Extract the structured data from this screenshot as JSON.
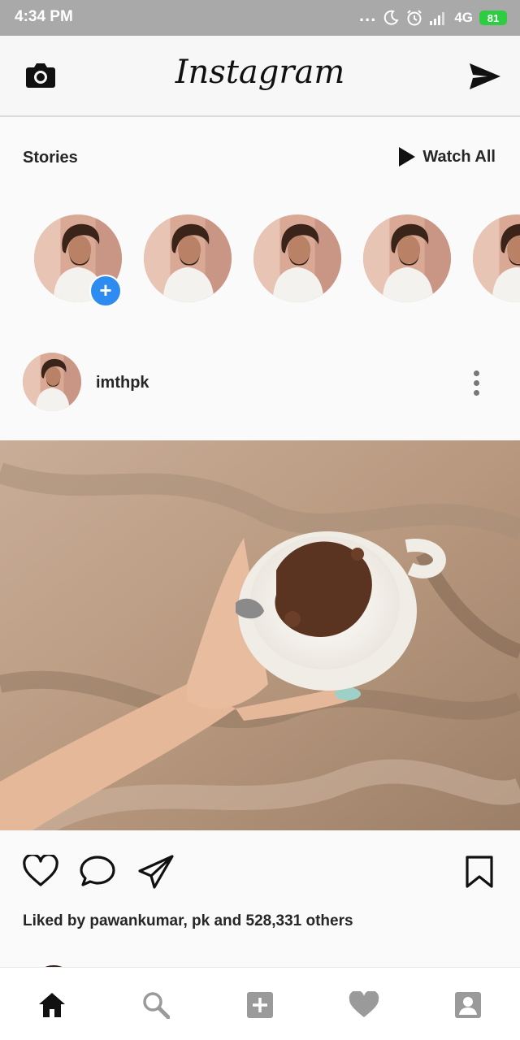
{
  "status_bar": {
    "time": "4:34 PM",
    "dots": "...",
    "network": "4G",
    "battery": "81"
  },
  "header": {
    "logo": "Instagram",
    "left_icon": "camera-icon",
    "right_icon": "send-icon"
  },
  "stories": {
    "title": "Stories",
    "watch_all": "Watch All",
    "items": [
      {
        "icon": "avatar",
        "has_add": true
      },
      {
        "icon": "avatar"
      },
      {
        "icon": "avatar"
      },
      {
        "icon": "avatar"
      },
      {
        "icon": "avatar"
      }
    ]
  },
  "post": {
    "username": "imthpk",
    "likes_text": "Liked by pawankumar, pk and 528,331 others"
  },
  "actions": [
    "heart-icon",
    "comment-icon",
    "share-icon",
    "bookmark-icon"
  ],
  "nav": [
    "home-icon",
    "search-icon",
    "add-icon",
    "heart-icon",
    "profile-icon"
  ],
  "colors": {
    "accent_blue": "#2e8cf0",
    "battery_green": "#2ecc40",
    "status_bar": "#a9a9a9"
  }
}
